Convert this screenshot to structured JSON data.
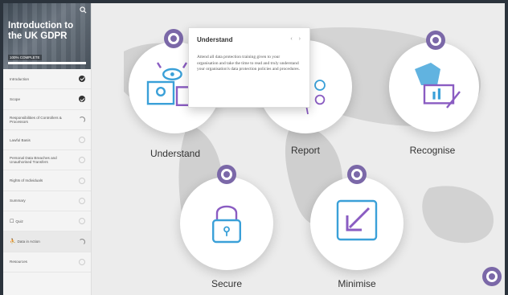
{
  "course": {
    "title": "Introduction to the UK GDPR",
    "subtitle": "100% COMPLETE",
    "progress": 1.0
  },
  "sidebar": {
    "items": [
      {
        "label": "Introduction",
        "status": "done"
      },
      {
        "label": "Scope",
        "status": "done"
      },
      {
        "label": "Responsibilities of Controllers & Processors",
        "status": "partial"
      },
      {
        "label": "Lawful Basis",
        "status": "empty"
      },
      {
        "label": "Personal Data Breaches and Unauthorised Transfers",
        "status": "empty"
      },
      {
        "label": "Rights of Individuals",
        "status": "empty"
      },
      {
        "label": "Summary",
        "status": "empty"
      },
      {
        "label": "Quiz",
        "status": "empty"
      },
      {
        "label": "Data in Action",
        "status": "partial"
      },
      {
        "label": "Resources",
        "status": "empty"
      }
    ]
  },
  "cards": [
    {
      "key": "understand",
      "label": "Understand"
    },
    {
      "key": "report",
      "label": "Report"
    },
    {
      "key": "recognise",
      "label": "Recognise"
    },
    {
      "key": "secure",
      "label": "Secure"
    },
    {
      "key": "minimise",
      "label": "Minimise"
    }
  ],
  "popup": {
    "title": "Understand",
    "body": "Attend all data protection training given to your organisation and take the time to read and truly understand your organisation's data protection policies and procedures.",
    "nav": "‹ ›"
  },
  "colors": {
    "accent": "#7b68a8",
    "icon_blue": "#3aa0d8",
    "icon_purple": "#8a5cc2"
  }
}
